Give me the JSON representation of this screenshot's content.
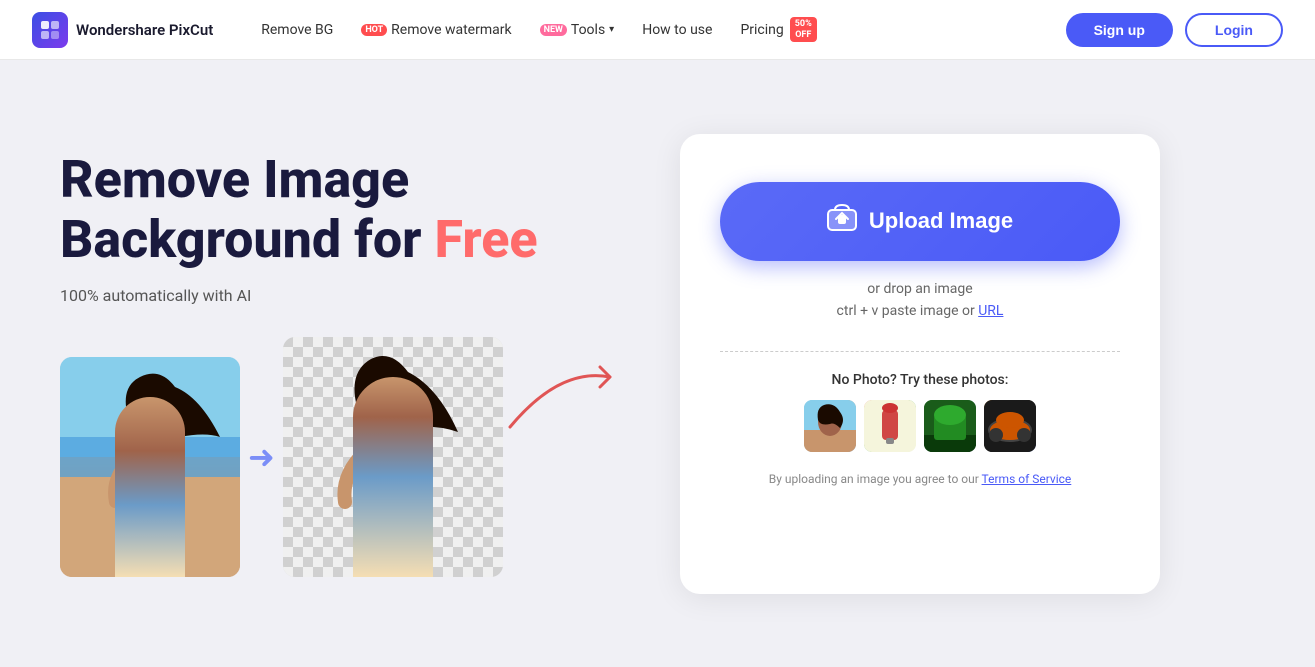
{
  "navbar": {
    "logo_text": "Wondershare PixCut",
    "nav_remove_bg": "Remove BG",
    "badge_hot": "HOT",
    "nav_remove_watermark": "Remove watermark",
    "badge_new": "NEW",
    "nav_tools": "Tools",
    "nav_how_to_use": "How to use",
    "nav_pricing": "Pricing",
    "pricing_badge_line1": "50%",
    "pricing_badge_line2": "OFF",
    "btn_signup": "Sign up",
    "btn_login": "Login"
  },
  "hero": {
    "title_line1": "Remove Image",
    "title_line2_prefix": "Background for ",
    "title_line2_free": "Free",
    "subtitle": "100% automatically with AI"
  },
  "upload_panel": {
    "upload_btn_label": "Upload Image",
    "drop_text": "or drop an image",
    "paste_text_prefix": "ctrl + v paste image or ",
    "paste_url": "URL",
    "no_photo_text": "No Photo? Try these photos:",
    "terms_prefix": "By uploading an image you agree to our ",
    "terms_link": "Terms of Service"
  }
}
